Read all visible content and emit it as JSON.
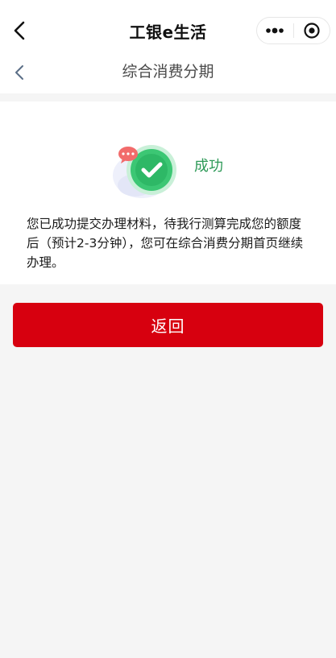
{
  "app": {
    "title": "工银e生活"
  },
  "page": {
    "title": "综合消费分期"
  },
  "result": {
    "status": "成功",
    "message": "您已成功提交办理材料，待我行测算完成您的额度后（预计2-3分钟），您可在综合消费分期首页继续办理。"
  },
  "actions": {
    "return_label": "返回"
  },
  "icons": {
    "app_back": "chevron-left-icon",
    "page_back": "chevron-left-icon",
    "more": "more-dots-icon",
    "close": "target-circle-icon",
    "success": "success-check-icon"
  },
  "colors": {
    "primary_red": "#d7000f",
    "success_green": "#2e9a58",
    "background": "#f5f5f5"
  }
}
